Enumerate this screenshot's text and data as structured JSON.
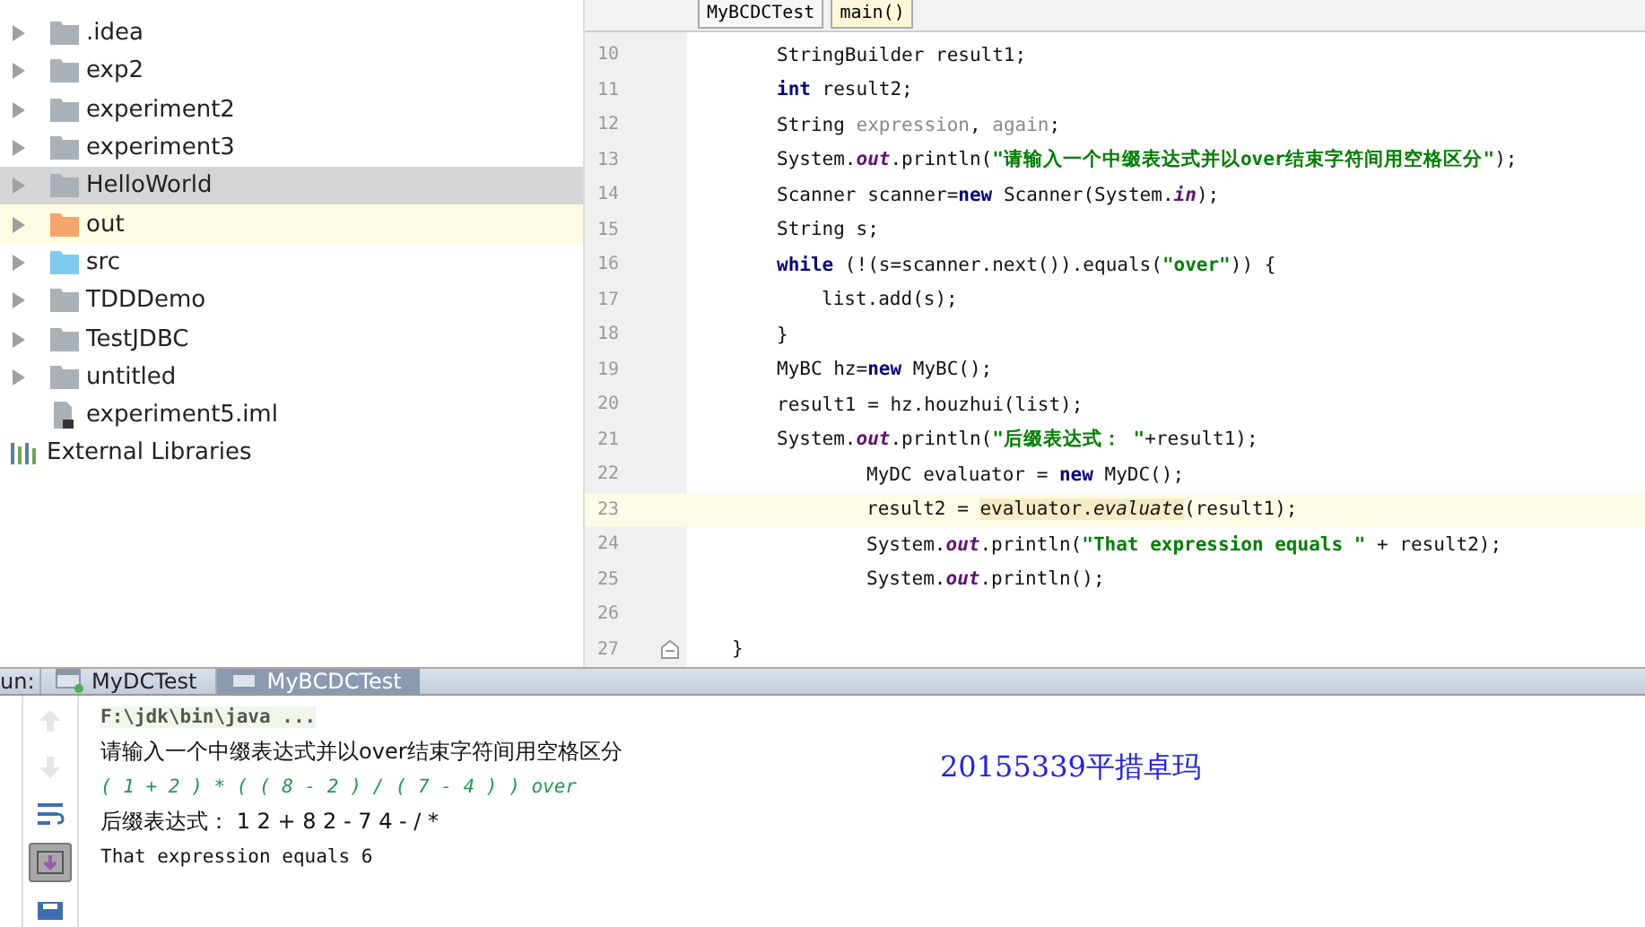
{
  "project_tree": {
    "items": [
      {
        "label": ".idea",
        "kind": "folder",
        "color": "#a9b0b8",
        "expandable": true,
        "selected": false,
        "highlighted": false
      },
      {
        "label": "exp2",
        "kind": "folder",
        "color": "#a9b0b8",
        "expandable": true,
        "selected": false,
        "highlighted": false
      },
      {
        "label": "experiment2",
        "kind": "folder",
        "color": "#a9b0b8",
        "expandable": true,
        "selected": false,
        "highlighted": false
      },
      {
        "label": "experiment3",
        "kind": "folder",
        "color": "#a9b0b8",
        "expandable": true,
        "selected": false,
        "highlighted": false
      },
      {
        "label": "HelloWorld",
        "kind": "folder",
        "color": "#a9b0b8",
        "expandable": true,
        "selected": true,
        "highlighted": false
      },
      {
        "label": "out",
        "kind": "folder",
        "color": "#f5a56b",
        "expandable": true,
        "selected": false,
        "highlighted": true
      },
      {
        "label": "src",
        "kind": "folder",
        "color": "#7ecbee",
        "expandable": true,
        "selected": false,
        "highlighted": false
      },
      {
        "label": "TDDDemo",
        "kind": "folder",
        "color": "#a9b0b8",
        "expandable": true,
        "selected": false,
        "highlighted": false
      },
      {
        "label": "TestJDBC",
        "kind": "folder",
        "color": "#a9b0b8",
        "expandable": true,
        "selected": false,
        "highlighted": false
      },
      {
        "label": "untitled",
        "kind": "folder",
        "color": "#a9b0b8",
        "expandable": true,
        "selected": false,
        "highlighted": false
      },
      {
        "label": "experiment5.iml",
        "kind": "file",
        "color": "#a9b0b8",
        "expandable": false,
        "selected": false,
        "highlighted": false
      },
      {
        "label": "External Libraries",
        "kind": "library",
        "color": "#5b7fa8",
        "expandable": false,
        "selected": false,
        "highlighted": false
      }
    ]
  },
  "breadcrumbs": [
    {
      "label": "MyBCDCTest",
      "kind": "class"
    },
    {
      "label": "main()",
      "kind": "method"
    }
  ],
  "editor": {
    "lines": [
      {
        "number": "10",
        "kind": "block",
        "current": false,
        "fold": false,
        "segments": [
          {
            "text": "StringBuilder result1;",
            "kind": "plain"
          }
        ]
      },
      {
        "number": "11",
        "kind": "block",
        "current": false,
        "fold": false,
        "segments": [
          {
            "text": "int",
            "kind": "keyword"
          },
          {
            "text": " result2;",
            "kind": "plain"
          }
        ]
      },
      {
        "number": "12",
        "kind": "block",
        "current": false,
        "fold": false,
        "segments": [
          {
            "text": "String ",
            "kind": "plain"
          },
          {
            "text": "expression",
            "kind": "unused"
          },
          {
            "text": ", ",
            "kind": "plain"
          },
          {
            "text": "again",
            "kind": "unused"
          },
          {
            "text": ";",
            "kind": "plain"
          }
        ]
      },
      {
        "number": "13",
        "kind": "block",
        "current": false,
        "fold": false,
        "segments": [
          {
            "text": "System.",
            "kind": "plain"
          },
          {
            "text": "out",
            "kind": "static"
          },
          {
            "text": ".println(",
            "kind": "plain"
          },
          {
            "text": "\"请输入一个中缀表达式并以over结束字符间用空格区分\"",
            "kind": "string"
          },
          {
            "text": ");",
            "kind": "plain"
          }
        ]
      },
      {
        "number": "14",
        "kind": "block",
        "current": false,
        "fold": false,
        "segments": [
          {
            "text": "Scanner scanner=",
            "kind": "plain"
          },
          {
            "text": "new",
            "kind": "keyword"
          },
          {
            "text": " Scanner(System.",
            "kind": "plain"
          },
          {
            "text": "in",
            "kind": "static"
          },
          {
            "text": ");",
            "kind": "plain"
          }
        ]
      },
      {
        "number": "15",
        "kind": "block",
        "current": false,
        "fold": false,
        "segments": [
          {
            "text": "String s;",
            "kind": "plain"
          }
        ]
      },
      {
        "number": "16",
        "kind": "block",
        "current": false,
        "fold": false,
        "segments": [
          {
            "text": "while",
            "kind": "keyword"
          },
          {
            "text": " (!(s=scanner.next()).equals(",
            "kind": "plain"
          },
          {
            "text": "\"over\"",
            "kind": "string"
          },
          {
            "text": ")) {",
            "kind": "plain"
          }
        ]
      },
      {
        "number": "17",
        "kind": "inner",
        "current": false,
        "fold": false,
        "segments": [
          {
            "text": "list.add(s);",
            "kind": "plain"
          }
        ]
      },
      {
        "number": "18",
        "kind": "block",
        "current": false,
        "fold": false,
        "segments": [
          {
            "text": "}",
            "kind": "plain"
          }
        ]
      },
      {
        "number": "19",
        "kind": "block",
        "current": false,
        "fold": false,
        "segments": [
          {
            "text": "MyBC hz=",
            "kind": "plain"
          },
          {
            "text": "new",
            "kind": "keyword"
          },
          {
            "text": " MyBC();",
            "kind": "plain"
          }
        ]
      },
      {
        "number": "20",
        "kind": "block",
        "current": false,
        "fold": false,
        "segments": [
          {
            "text": "result1 = hz.houzhui(list);",
            "kind": "plain"
          }
        ]
      },
      {
        "number": "21",
        "kind": "block",
        "current": false,
        "fold": false,
        "segments": [
          {
            "text": "System.",
            "kind": "plain"
          },
          {
            "text": "out",
            "kind": "static"
          },
          {
            "text": ".println(",
            "kind": "plain"
          },
          {
            "text": "\"后缀表达式： \"",
            "kind": "string"
          },
          {
            "text": "+result1);",
            "kind": "plain"
          }
        ]
      },
      {
        "number": "22",
        "kind": "deep",
        "current": false,
        "fold": false,
        "segments": [
          {
            "text": "MyDC evaluator = ",
            "kind": "plain"
          },
          {
            "text": "new",
            "kind": "keyword"
          },
          {
            "text": " MyDC();",
            "kind": "plain"
          }
        ]
      },
      {
        "number": "23",
        "kind": "deep",
        "current": true,
        "fold": false,
        "segments": [
          {
            "text": "result2 = ",
            "kind": "plain"
          },
          {
            "text": "evaluator.",
            "kind": "match"
          },
          {
            "text": "evaluate",
            "kind": "match-italic"
          },
          {
            "text": "(result1);",
            "kind": "plain"
          }
        ]
      },
      {
        "number": "24",
        "kind": "deep",
        "current": false,
        "fold": false,
        "segments": [
          {
            "text": "System.",
            "kind": "plain"
          },
          {
            "text": "out",
            "kind": "static"
          },
          {
            "text": ".println(",
            "kind": "plain"
          },
          {
            "text": "\"That expression equals \"",
            "kind": "string"
          },
          {
            "text": " + result2);",
            "kind": "plain"
          }
        ]
      },
      {
        "number": "25",
        "kind": "deep",
        "current": false,
        "fold": false,
        "segments": [
          {
            "text": "System.",
            "kind": "plain"
          },
          {
            "text": "out",
            "kind": "static"
          },
          {
            "text": ".println();",
            "kind": "plain"
          }
        ]
      },
      {
        "number": "26",
        "current": false,
        "fold": false
      },
      {
        "number": "27",
        "kind": "method",
        "current": false,
        "fold": true,
        "segments": [
          {
            "text": "}",
            "kind": "plain"
          }
        ]
      }
    ]
  },
  "run_panel": {
    "label": "un:",
    "tabs": [
      {
        "label": "MyDCTest",
        "selected": false
      },
      {
        "label": "MyBCDCTest",
        "selected": true
      }
    ],
    "tools": [
      {
        "kind": "up",
        "disabled": true
      },
      {
        "kind": "down",
        "disabled": true
      },
      {
        "kind": "wrap",
        "disabled": false
      },
      {
        "kind": "scroll-end",
        "disabled": false
      },
      {
        "kind": "print",
        "disabled": false
      }
    ],
    "console": [
      {
        "text": "F:\\jdk\\bin\\java ...",
        "kind": "command"
      },
      {
        "text": "请输入一个中缀表达式并以over结束字符间用空格区分",
        "kind": "output"
      },
      {
        "text": "( 1 + 2 ) * ( ( 8 - 2 ) / ( 7 - 4 ) ) over",
        "kind": "input"
      },
      {
        "text": "后缀表达式： 1 2 + 8 2 - 7 4 - / *",
        "kind": "output"
      },
      {
        "text": "That expression equals 6",
        "kind": "result"
      }
    ],
    "note": "20155339平措卓玛"
  }
}
